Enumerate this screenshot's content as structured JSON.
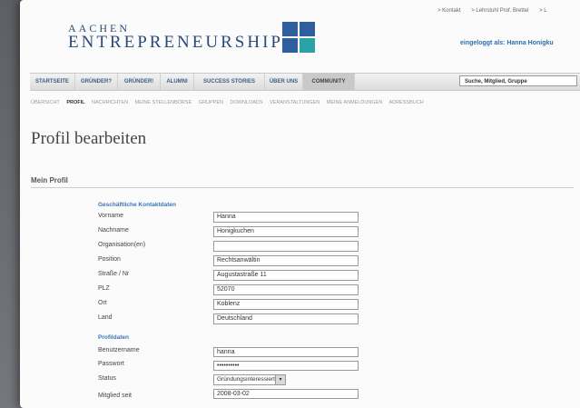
{
  "top_links": [
    "> Kontakt",
    "> Lehrstuhl Prof. Brettel",
    "> L"
  ],
  "logo": {
    "line1": "AACHEN",
    "line2": "ENTREPRENEURSHIP"
  },
  "user": {
    "logged_in_text": "eingeloggt als: Hanna Honigku"
  },
  "nav": {
    "items": [
      "STARTSEITE",
      "GRÜNDER?",
      "GRÜNDER!",
      "ALUMNI",
      "SUCCESS STORIES",
      "ÜBER UNS",
      "COMMUNITY"
    ],
    "active": "COMMUNITY"
  },
  "search": {
    "placeholder": "Suche, Mitglied, Gruppe"
  },
  "subnav": {
    "items": [
      "ÜBERSICHT",
      "PROFIL",
      "NACHRICHTEN",
      "MEINE STELLENBÖRSE",
      "GRUPPEN",
      "DOWNLOADS",
      "VERANSTALTUNGEN",
      "MEINE ANMELDUNGEN",
      "ADRESSBUCH"
    ],
    "active": "PROFIL"
  },
  "page_title": "Profil bearbeiten",
  "section_title": "Mein Profil",
  "contact_group": {
    "title": "Geschäftliche Kontaktdaten",
    "fields": [
      {
        "label": "Vorname",
        "value": "Hanna"
      },
      {
        "label": "Nachname",
        "value": "Honigkuchen"
      },
      {
        "label": "Organisation(en)",
        "value": ""
      },
      {
        "label": "Position",
        "value": "Rechtsanwältin"
      },
      {
        "label": "Straße / Nr",
        "value": "Augustastraße 11"
      },
      {
        "label": "PLZ",
        "value": "52070"
      },
      {
        "label": "Ort",
        "value": "Koblenz"
      },
      {
        "label": "Land",
        "value": "Deutschland"
      }
    ]
  },
  "profile_group": {
    "title": "Profildaten",
    "username_label": "Benutzername",
    "username_value": "hanna",
    "password_label": "Passwort",
    "password_value": "••••••••••",
    "status_label": "Status",
    "status_value": "Gründungsinteressiert",
    "member_since_label": "Mitglied seit",
    "member_since_value": "2008-03-02"
  },
  "colors": {
    "accent": "#3a75b6",
    "logo": "#2a4a7a",
    "logo_teal": "#2aa3a6"
  }
}
